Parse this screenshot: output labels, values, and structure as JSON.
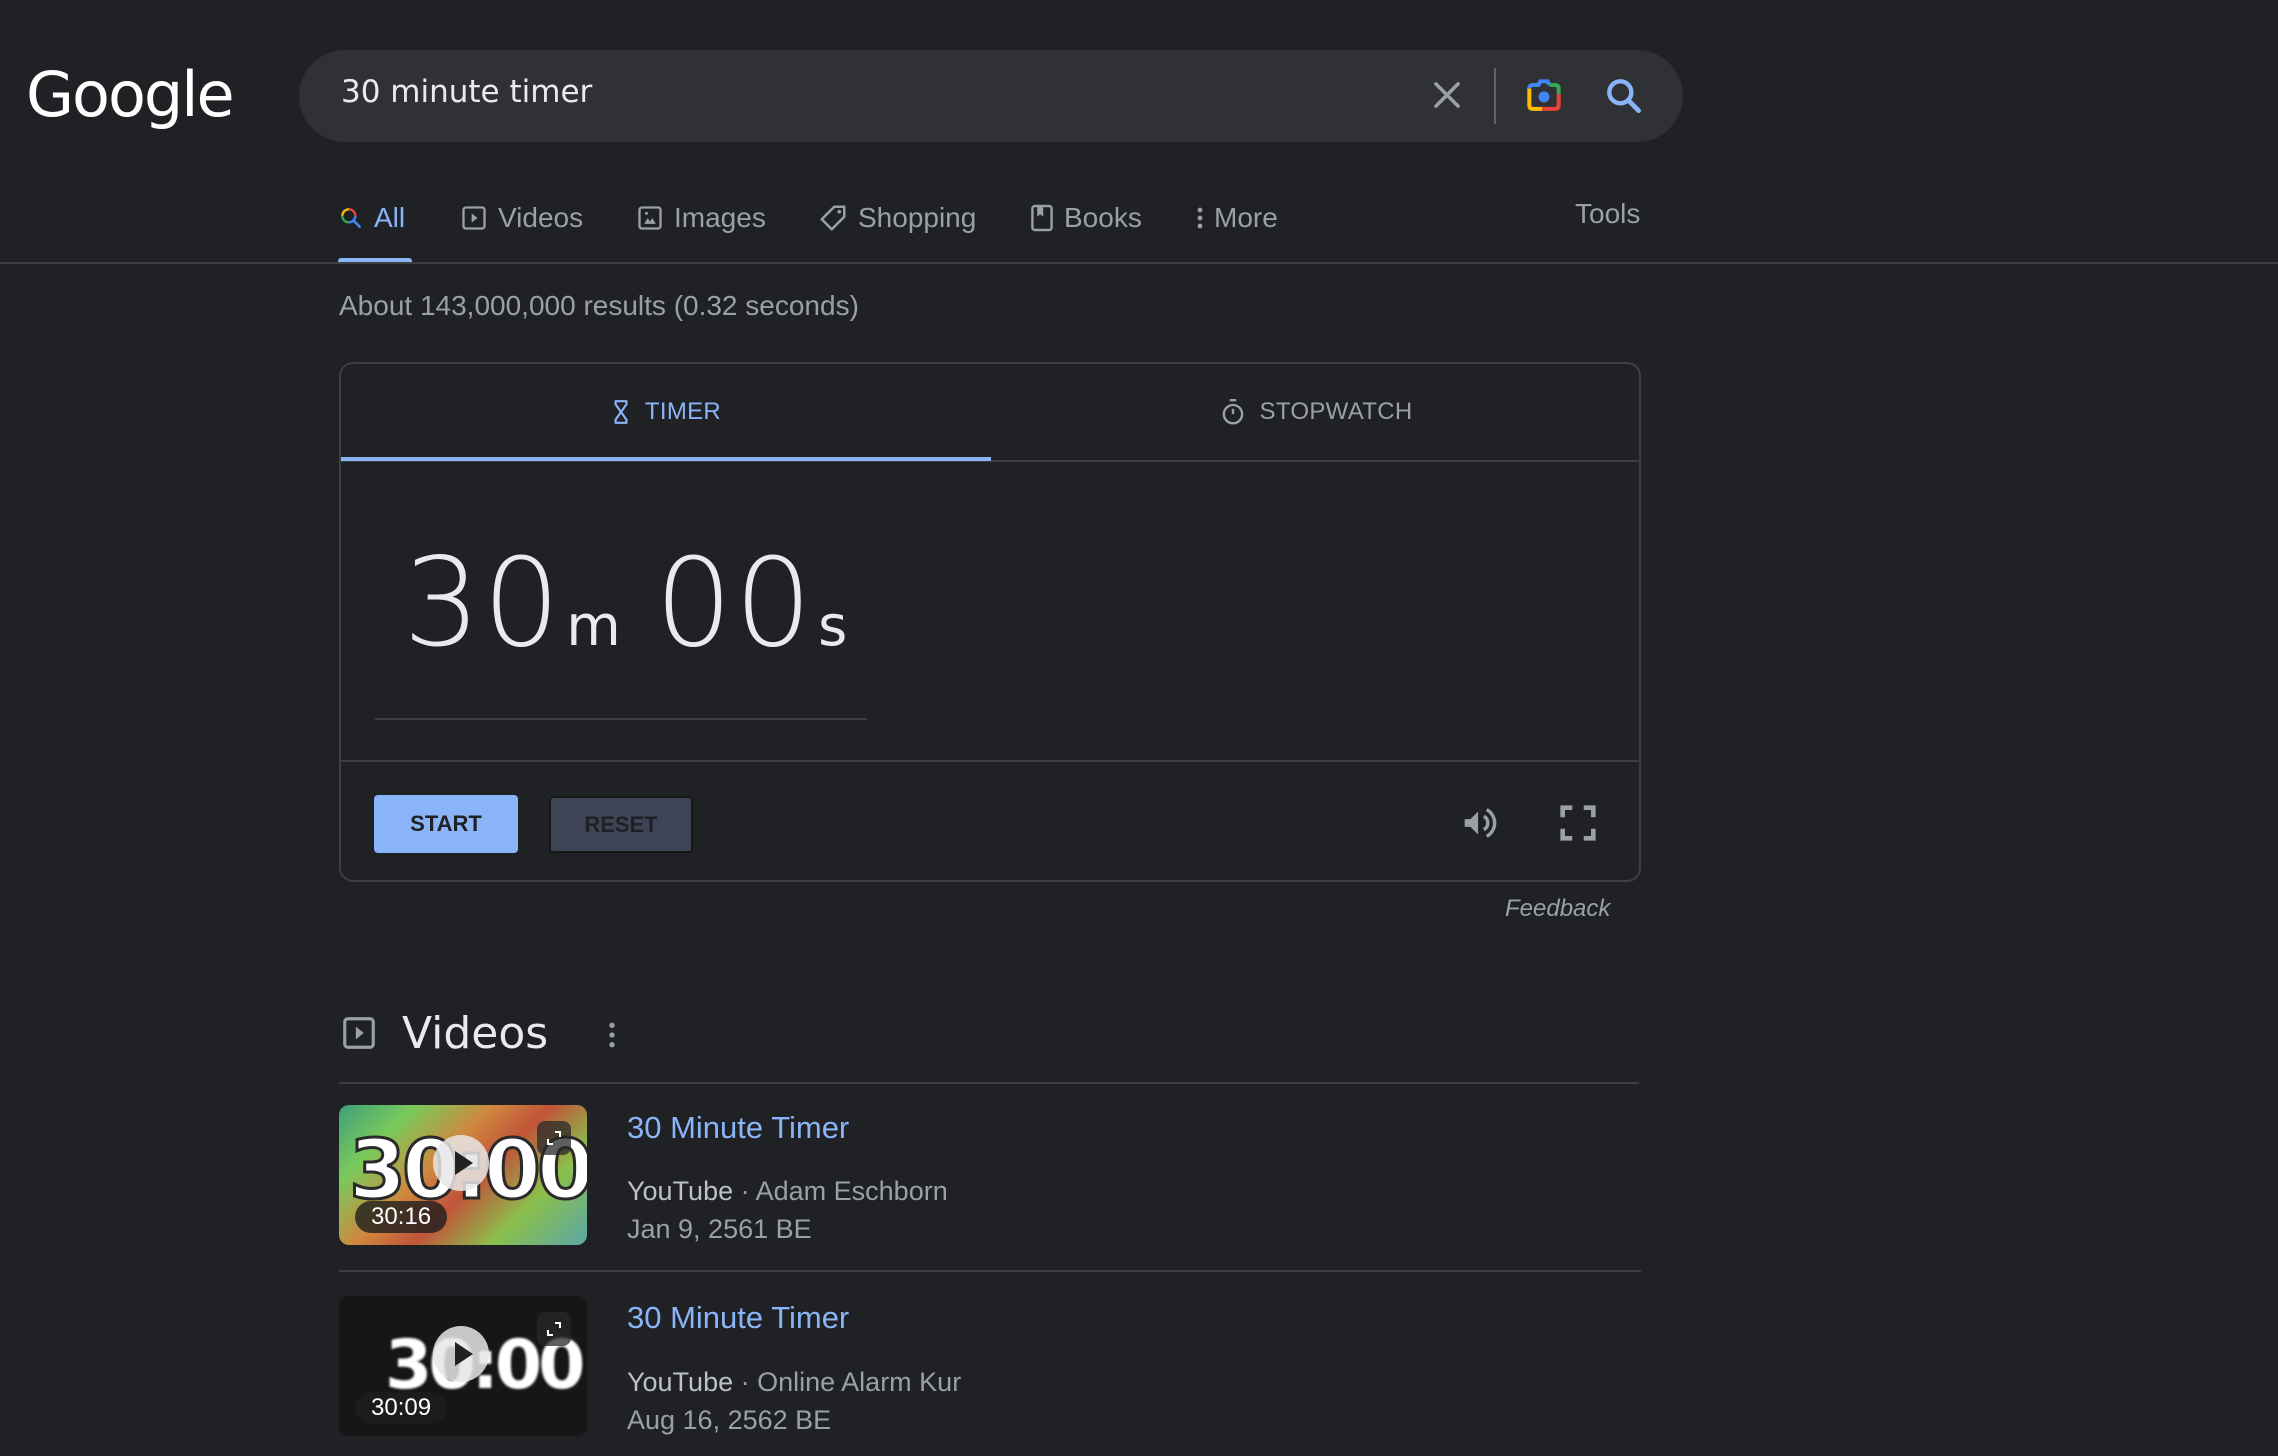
{
  "header": {
    "logo": "Google",
    "search": {
      "value": "30 minute timer",
      "clear_icon": "close-icon",
      "lens_icon": "google-lens-camera-icon",
      "search_icon": "search-icon"
    }
  },
  "nav": {
    "tabs": [
      {
        "label": "All",
        "icon": "search-icon",
        "active": true
      },
      {
        "label": "Videos",
        "icon": "video-play-icon",
        "active": false
      },
      {
        "label": "Images",
        "icon": "image-icon",
        "active": false
      },
      {
        "label": "Shopping",
        "icon": "tag-icon",
        "active": false
      },
      {
        "label": "Books",
        "icon": "book-icon",
        "active": false
      },
      {
        "label": "More",
        "icon": "more-vertical-icon",
        "active": false
      }
    ],
    "tools": "Tools"
  },
  "result_stats": "About 143,000,000 results (0.32 seconds)",
  "timer_card": {
    "tabs": [
      {
        "label": "TIMER",
        "icon": "hourglass-icon",
        "active": true
      },
      {
        "label": "STOPWATCH",
        "icon": "stopwatch-icon",
        "active": false
      }
    ],
    "minutes": "30",
    "minutes_unit": "m",
    "seconds": "00",
    "seconds_unit": "s",
    "start_label": "START",
    "reset_label": "RESET",
    "sound_icon": "volume-icon",
    "fullscreen_icon": "fullscreen-icon",
    "feedback": "Feedback"
  },
  "videos": {
    "title": "Videos",
    "items": [
      {
        "title": "30 Minute Timer",
        "source": "YouTube",
        "channel": "Adam Eschborn",
        "date": "Jan 9, 2561 BE",
        "duration": "30:16",
        "thumb_text": "30:00"
      },
      {
        "title": "30 Minute Timer",
        "source": "YouTube",
        "channel": "Online Alarm Kur",
        "date": "Aug 16, 2562 BE",
        "duration": "30:09",
        "thumb_text": "30:00"
      }
    ]
  },
  "colors": {
    "background": "#202124",
    "accent": "#8ab4f8",
    "text_primary": "#e8eaed",
    "text_secondary": "#9aa0a6",
    "divider": "#3c4043"
  }
}
